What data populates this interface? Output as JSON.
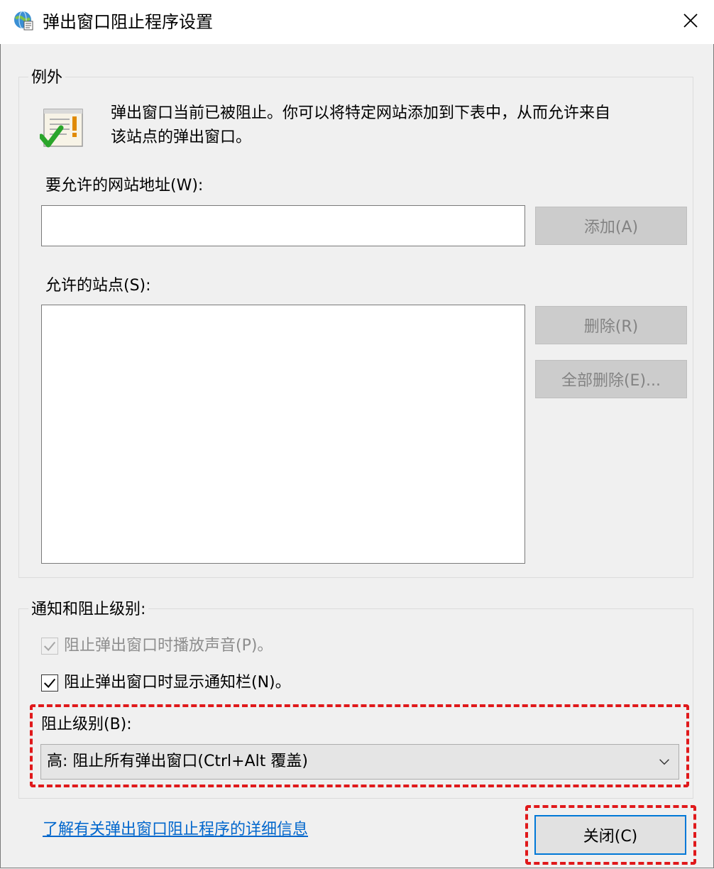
{
  "window": {
    "title": "弹出窗口阻止程序设置",
    "title_icon": "globe-settings-icon",
    "close_icon": "close-icon"
  },
  "exceptions": {
    "group_label": "例外",
    "info_icon": "document-check-warning-icon",
    "info_line1": "弹出窗口当前已被阻止。你可以将特定网站添加到下表中，从而允许来自",
    "info_line2": "该站点的弹出窗口。",
    "address_label": "要允许的网站地址(W):",
    "address_value": "",
    "add_button": "添加(A)",
    "allowed_label": "允许的站点(S):",
    "allowed_sites": [],
    "remove_button": "删除(R)",
    "remove_all_button": "全部删除(E)..."
  },
  "notifications": {
    "group_label": "通知和阻止级别:",
    "play_sound_label": "阻止弹出窗口时播放声音(P)。",
    "play_sound_checked": true,
    "play_sound_enabled": false,
    "show_bar_label": "阻止弹出窗口时显示通知栏(N)。",
    "show_bar_checked": true,
    "level_label": "阻止级别(B):",
    "level_value": "高: 阻止所有弹出窗口(Ctrl+Alt 覆盖)"
  },
  "footer": {
    "learn_more_link": "了解有关弹出窗口阻止程序的详细信息",
    "close_button": "关闭(C)"
  },
  "colors": {
    "highlight_dashed": "#e0191b",
    "link": "#0066cc",
    "focus_border": "#0078d7"
  }
}
